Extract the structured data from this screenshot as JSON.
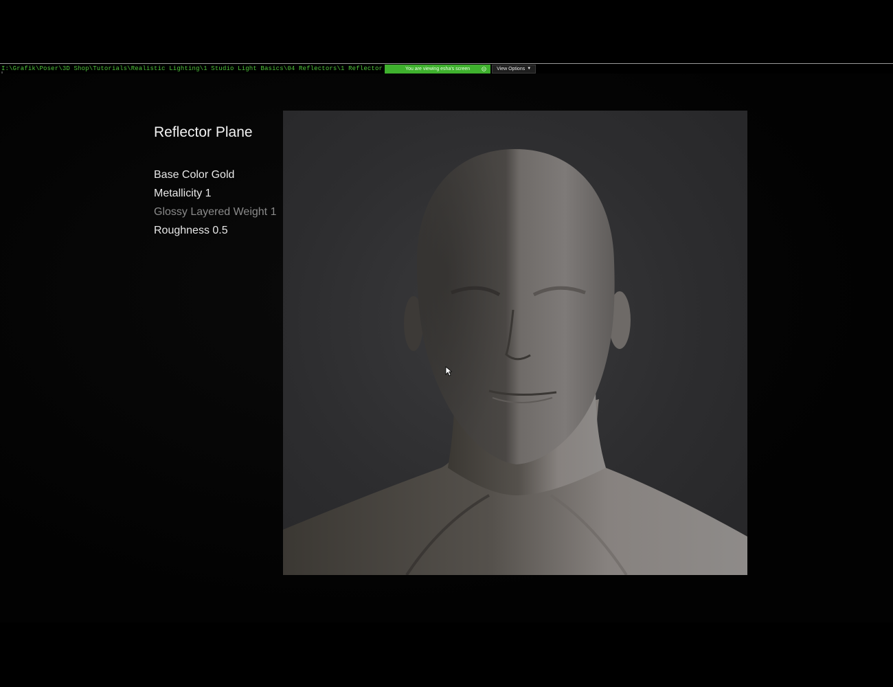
{
  "share_bar": {
    "path": "I:\\Grafik\\Poser\\3D Shop\\Tutorials\\Realistic Lighting\\1 Studio Light Basics\\04 Reflectors\\1 Reflector",
    "viewing_banner": "You are viewing esha's screen",
    "view_options_label": "View Options",
    "banner_color": "#3fb12e"
  },
  "slide": {
    "title": "Reflector Plane",
    "properties": [
      {
        "label": "Base Color Gold",
        "dimmed": false
      },
      {
        "label": "Metallicity 1",
        "dimmed": false
      },
      {
        "label": "Glossy Layered Weight 1",
        "dimmed": true
      },
      {
        "label": "Roughness 0.5",
        "dimmed": false
      }
    ]
  },
  "render_preview": {
    "subject": "3D render of a bald human head and shoulders lit from the left"
  },
  "icons": {
    "hangup": "phone-hangup-icon",
    "view_options_chevron": "chevron-down-icon",
    "pointer": "mouse-pointer-icon"
  }
}
